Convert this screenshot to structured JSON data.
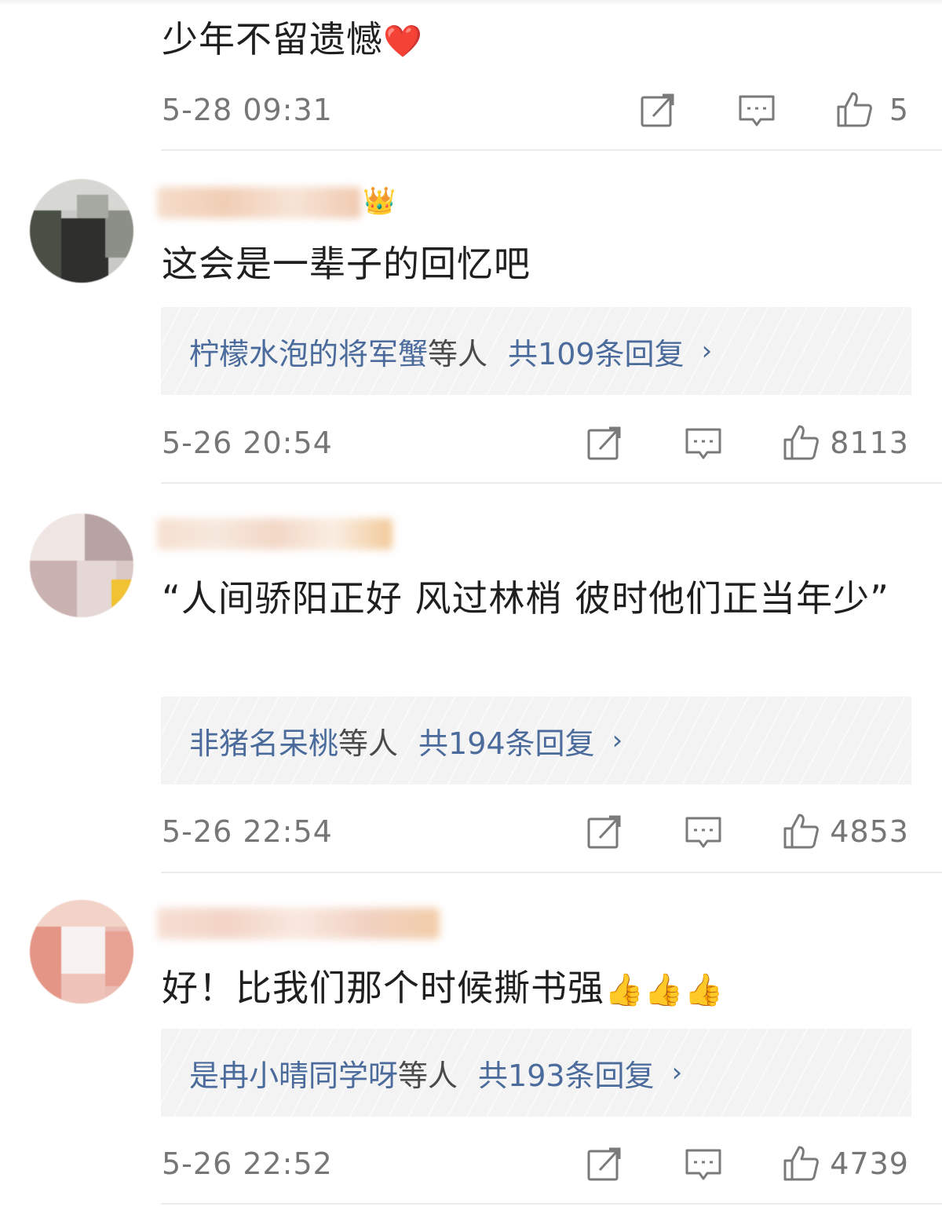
{
  "comments": [
    {
      "text": "少年不留遗憾",
      "text_emoji": "❤️",
      "timestamp": "5-28 09:31",
      "likes": "5",
      "repost_icon": "repost-icon",
      "reply_icon": "comment-icon",
      "like_icon": "thumbs-up-icon"
    },
    {
      "crown_icon": "👑",
      "text": "这会是一辈子的回忆吧",
      "reply_names": "柠檬水泡的将军蟹",
      "reply_suffix": "等人",
      "reply_count": "共109条回复",
      "reply_chevron": "›",
      "timestamp": "5-26 20:54",
      "likes": "8113"
    },
    {
      "text": "“人间骄阳正好 风过林梢 彼时他们正当年少”",
      "reply_names": "非猪名呆桃",
      "reply_suffix": "等人",
      "reply_count": "共194条回复",
      "reply_chevron": "›",
      "timestamp": "5-26 22:54",
      "likes": "4853"
    },
    {
      "text": "好！比我们那个时候撕书强",
      "text_emoji": "👍👍👍",
      "reply_names": "是冉小晴同学呀",
      "reply_suffix": "等人",
      "reply_count": "共193条回复",
      "reply_chevron": "›",
      "timestamp": "5-26 22:52",
      "likes": "4739"
    }
  ],
  "colors": {
    "link_blue": "#4a6b9b",
    "meta_gray": "#767676",
    "reply_bg": "#f3f3f3",
    "divider": "#ececec"
  }
}
